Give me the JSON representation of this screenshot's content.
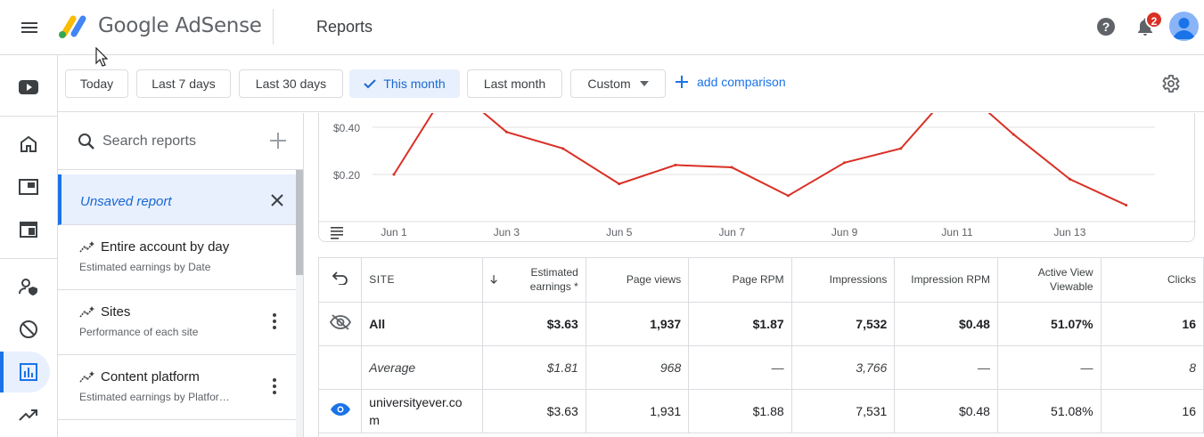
{
  "app": {
    "brand": "Google AdSense",
    "page_title": "Reports",
    "notification_count": "2",
    "icons": [
      "menu-icon",
      "help-icon",
      "bell-icon",
      "avatar"
    ]
  },
  "rail": {
    "items": [
      {
        "name": "youtube-icon"
      },
      {
        "name": "home-icon"
      },
      {
        "name": "ads-icon"
      },
      {
        "name": "sites-icon"
      },
      {
        "name": "account-icon"
      },
      {
        "name": "block-icon"
      },
      {
        "name": "reports-icon",
        "active": true
      },
      {
        "name": "trending-icon"
      }
    ]
  },
  "filters": {
    "today": "Today",
    "last7": "Last 7 days",
    "last30": "Last 30 days",
    "this_month": "This month",
    "last_month": "Last month",
    "custom": "Custom",
    "add_comparison": "add comparison"
  },
  "reports": {
    "search_placeholder": "Search reports",
    "unsaved": "Unsaved report",
    "items": [
      {
        "title": "Entire account by day",
        "subtitle": "Estimated earnings by Date"
      },
      {
        "title": "Sites",
        "subtitle": "Performance of each site"
      },
      {
        "title": "Content platform",
        "subtitle": "Estimated earnings by Platfor…"
      }
    ]
  },
  "chart_data": {
    "type": "line",
    "x": [
      "Jun 1",
      "Jun 2",
      "Jun 3",
      "Jun 4",
      "Jun 5",
      "Jun 6",
      "Jun 7",
      "Jun 8",
      "Jun 9",
      "Jun 10",
      "Jun 11",
      "Jun 12",
      "Jun 13",
      "Jun 14"
    ],
    "tick_labels": [
      "Jun 1",
      "Jun 3",
      "Jun 5",
      "Jun 7",
      "Jun 9",
      "Jun 11",
      "Jun 13"
    ],
    "y_tick_labels": [
      "$0.40",
      "$0.20"
    ],
    "series": [
      {
        "values": [
          0.2,
          0.58,
          0.38,
          0.31,
          0.16,
          0.24,
          0.23,
          0.11,
          0.25,
          0.31,
          0.58,
          0.37,
          0.18,
          0.07
        ]
      }
    ],
    "ylim": [
      0,
      0.6
    ],
    "color": "#d93025",
    "grid": true
  },
  "table": {
    "headers": {
      "site": "SITE",
      "earnings": "Estimated earnings *",
      "page_views": "Page views",
      "page_rpm": "Page RPM",
      "impressions": "Impressions",
      "impression_rpm": "Impression RPM",
      "active_view": "Active View Viewable",
      "clicks": "Clicks"
    },
    "rows": [
      {
        "type": "all",
        "site": "All",
        "earnings": "$3.63",
        "page_views": "1,937",
        "page_rpm": "$1.87",
        "impressions": "7,532",
        "impression_rpm": "$0.48",
        "active_view": "51.07%",
        "clicks": "16"
      },
      {
        "type": "avg",
        "site": "Average",
        "earnings": "$1.81",
        "page_views": "968",
        "page_rpm": "—",
        "impressions": "3,766",
        "impression_rpm": "—",
        "active_view": "—",
        "clicks": "8"
      },
      {
        "type": "site",
        "site": "universityever.co m",
        "earnings": "$3.63",
        "page_views": "1,931",
        "page_rpm": "$1.88",
        "impressions": "7,531",
        "impression_rpm": "$0.48",
        "active_view": "51.08%",
        "clicks": "16"
      }
    ]
  }
}
